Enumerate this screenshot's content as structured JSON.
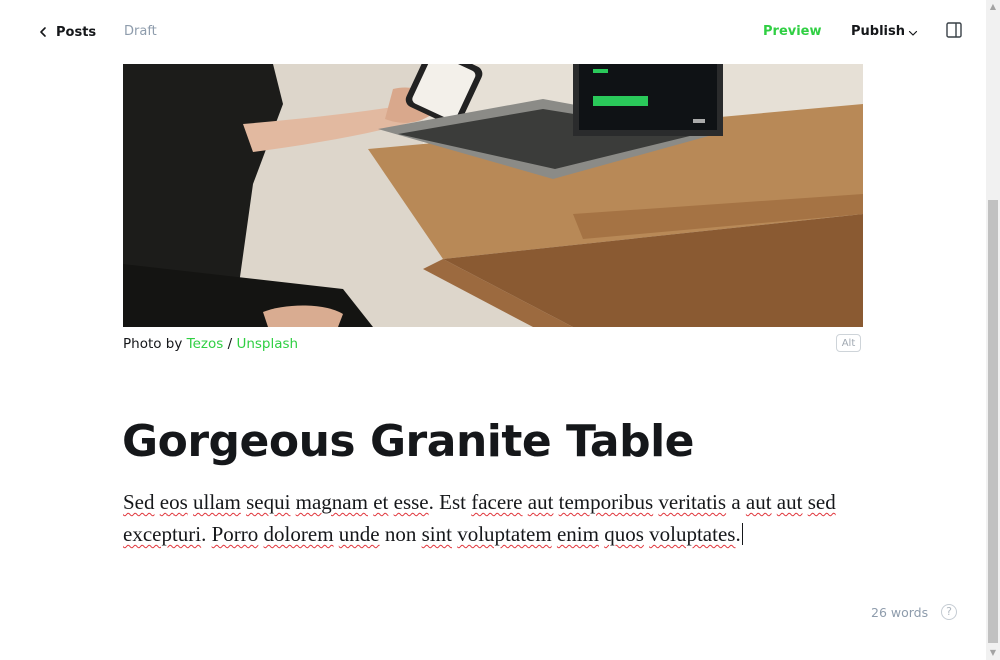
{
  "header": {
    "back_label": "Posts",
    "status": "Draft",
    "preview_label": "Preview",
    "publish_label": "Publish"
  },
  "feature_image": {
    "caption_prefix": "Photo by ",
    "author": "Tezos",
    "separator": " / ",
    "source": "Unsplash",
    "alt_label": "Alt"
  },
  "post": {
    "title": "Gorgeous Granite Table",
    "body_tokens": [
      {
        "t": "Sed",
        "err": true
      },
      {
        "t": " "
      },
      {
        "t": "eos",
        "err": true
      },
      {
        "t": " "
      },
      {
        "t": "ullam",
        "err": true
      },
      {
        "t": " "
      },
      {
        "t": "sequi",
        "err": true
      },
      {
        "t": " "
      },
      {
        "t": "magnam",
        "err": true
      },
      {
        "t": " "
      },
      {
        "t": "et",
        "err": true
      },
      {
        "t": " "
      },
      {
        "t": "esse",
        "err": true
      },
      {
        "t": ". Est "
      },
      {
        "t": "facere",
        "err": true
      },
      {
        "t": " "
      },
      {
        "t": "aut",
        "err": true
      },
      {
        "t": " "
      },
      {
        "t": "temporibus",
        "err": true
      },
      {
        "t": " "
      },
      {
        "t": "veritatis",
        "err": true
      },
      {
        "t": " a "
      },
      {
        "t": "aut",
        "err": true
      },
      {
        "t": " "
      },
      {
        "t": "aut",
        "err": true
      },
      {
        "t": " "
      },
      {
        "t": "sed",
        "err": true
      },
      {
        "t": " "
      },
      {
        "t": "excepturi",
        "err": true
      },
      {
        "t": ". "
      },
      {
        "t": "Porro",
        "err": true
      },
      {
        "t": " "
      },
      {
        "t": "dolorem",
        "err": true
      },
      {
        "t": " "
      },
      {
        "t": "unde",
        "err": true
      },
      {
        "t": " non "
      },
      {
        "t": "sint",
        "err": true
      },
      {
        "t": " "
      },
      {
        "t": "voluptatem",
        "err": true
      },
      {
        "t": " "
      },
      {
        "t": "enim",
        "err": true
      },
      {
        "t": " "
      },
      {
        "t": "quos",
        "err": true
      },
      {
        "t": " "
      },
      {
        "t": "voluptates",
        "err": true
      },
      {
        "t": "."
      }
    ]
  },
  "footer": {
    "word_count": "26 words",
    "help_label": "?"
  },
  "icons": {
    "back": "chevron-left-icon",
    "publish_dropdown": "chevron-down-icon",
    "sidebar": "sidebar-panel-icon"
  },
  "colors": {
    "accent": "#30cf43",
    "text": "#15171a",
    "muted": "#8e9cac"
  }
}
